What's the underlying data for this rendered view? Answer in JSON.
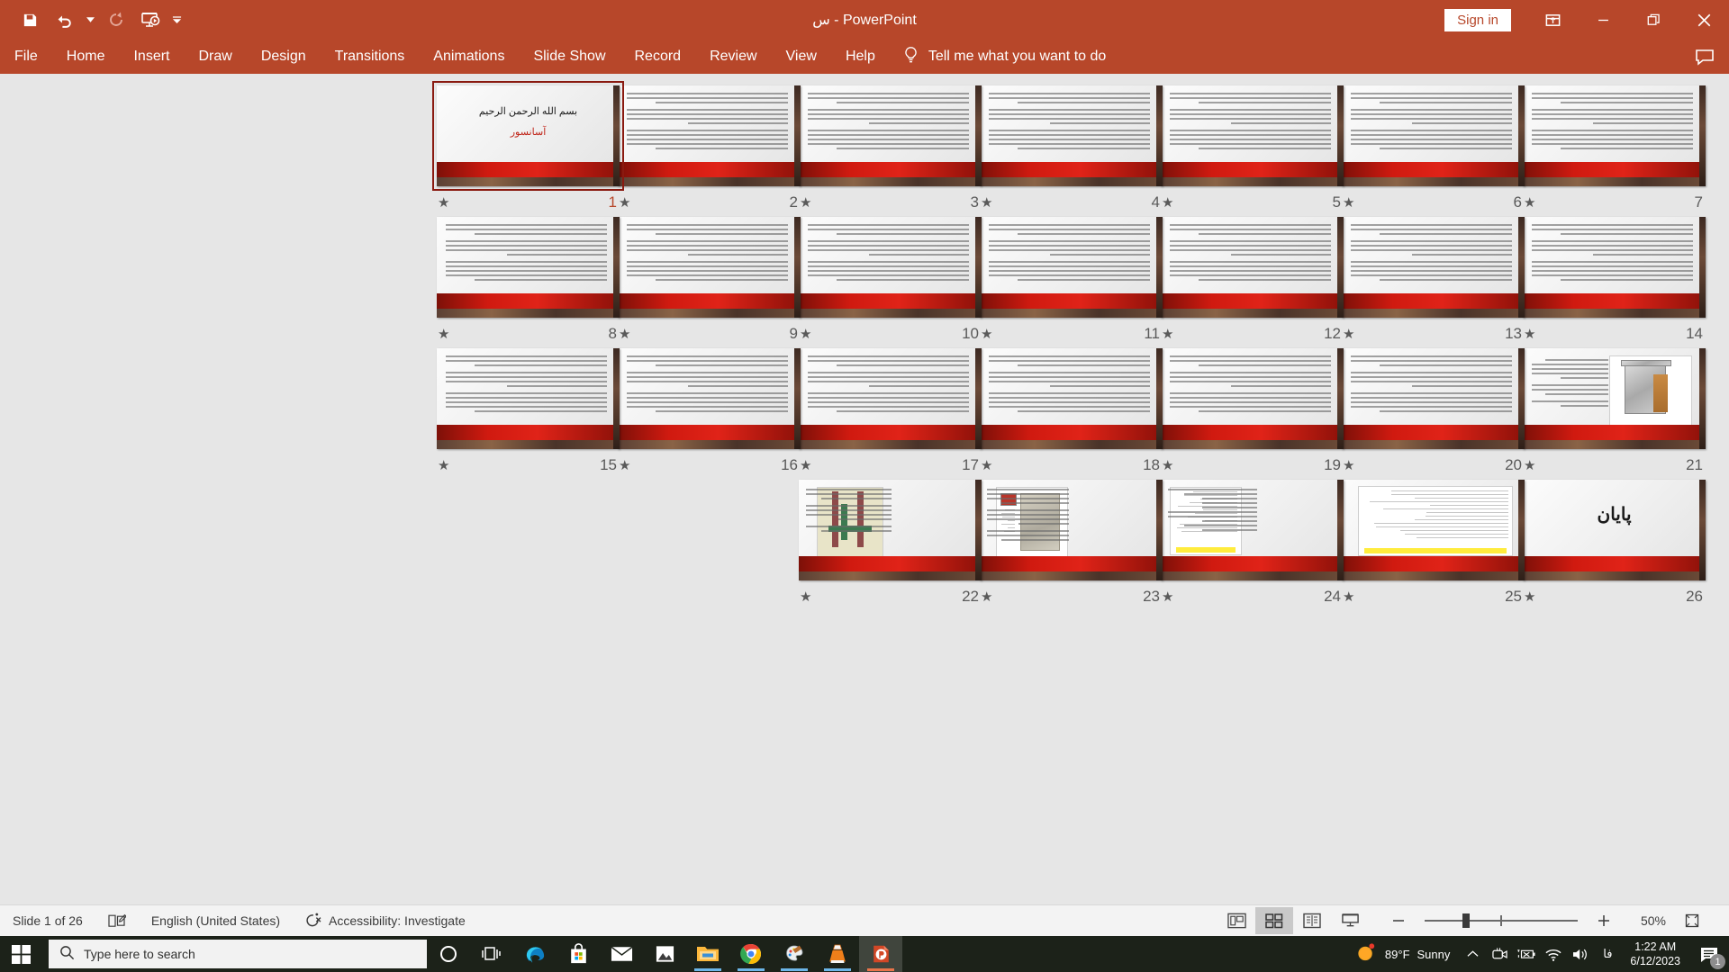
{
  "titlebar": {
    "document_title": "س  -  PowerPoint",
    "quick_access": [
      {
        "name": "save",
        "label": "Save",
        "icon": "save-icon"
      },
      {
        "name": "undo",
        "label": "Undo",
        "icon": "undo-icon"
      },
      {
        "name": "undo-dropdown",
        "label": "Undo options",
        "icon": "chevron-down-icon"
      },
      {
        "name": "redo",
        "label": "Redo",
        "icon": "redo-icon"
      },
      {
        "name": "start-slideshow",
        "label": "Start From Beginning",
        "icon": "slideshow-icon"
      },
      {
        "name": "customize-qat",
        "label": "Customize Quick Access Toolbar",
        "icon": "chevron-down-small-icon"
      }
    ],
    "signin_label": "Sign in",
    "ribbon_display_label": "Ribbon Display Options",
    "minimize_label": "Minimize",
    "restore_label": "Restore Down",
    "close_label": "Close"
  },
  "ribbon": {
    "tabs": [
      {
        "label": "File"
      },
      {
        "label": "Home"
      },
      {
        "label": "Insert"
      },
      {
        "label": "Draw"
      },
      {
        "label": "Design"
      },
      {
        "label": "Transitions"
      },
      {
        "label": "Animations"
      },
      {
        "label": "Slide Show"
      },
      {
        "label": "Record"
      },
      {
        "label": "Review"
      },
      {
        "label": "View"
      },
      {
        "label": "Help"
      }
    ],
    "tellme_placeholder": "Tell me what you want to do",
    "comments_label": "Comments"
  },
  "sorter": {
    "slides": [
      {
        "number": "7",
        "type": "text",
        "star": "★"
      },
      {
        "number": "6",
        "type": "text",
        "star": "★"
      },
      {
        "number": "5",
        "type": "text",
        "star": "★"
      },
      {
        "number": "4",
        "type": "text",
        "star": "★"
      },
      {
        "number": "3",
        "type": "text",
        "star": "★"
      },
      {
        "number": "2",
        "type": "text",
        "star": "★"
      },
      {
        "number": "1",
        "type": "title",
        "star": "★",
        "selected": true,
        "line1": "بسم الله الرحمن الرحيم",
        "line2": "آسانسور"
      },
      {
        "number": "14",
        "type": "text",
        "star": "★"
      },
      {
        "number": "13",
        "type": "text",
        "star": "★"
      },
      {
        "number": "12",
        "type": "text",
        "star": "★"
      },
      {
        "number": "11",
        "type": "text",
        "star": "★"
      },
      {
        "number": "10",
        "type": "text",
        "star": "★"
      },
      {
        "number": "9",
        "type": "text",
        "star": "★"
      },
      {
        "number": "8",
        "type": "text",
        "star": "★"
      },
      {
        "number": "21",
        "type": "diagram",
        "star": "★"
      },
      {
        "number": "20",
        "type": "text",
        "star": "★"
      },
      {
        "number": "19",
        "type": "text",
        "star": "★"
      },
      {
        "number": "18",
        "type": "text",
        "star": "★"
      },
      {
        "number": "17",
        "type": "text",
        "star": "★"
      },
      {
        "number": "16",
        "type": "text",
        "star": "★"
      },
      {
        "number": "15",
        "type": "text",
        "star": "★"
      },
      {
        "number": "26",
        "type": "end",
        "star": "★",
        "line1": "پایان"
      },
      {
        "number": "25",
        "type": "plan",
        "star": "★"
      },
      {
        "number": "24",
        "type": "plan2",
        "star": "★"
      },
      {
        "number": "23",
        "type": "cabin",
        "star": "★"
      },
      {
        "number": "22",
        "type": "rails",
        "star": "★"
      }
    ]
  },
  "statusbar": {
    "slide_counter": "Slide 1 of 26",
    "notes_icon_label": "Notes",
    "language": "English (United States)",
    "accessibility": "Accessibility: Investigate",
    "views": [
      {
        "name": "normal-view",
        "label": "Normal",
        "active": false
      },
      {
        "name": "slide-sorter-view",
        "label": "Slide Sorter",
        "active": true
      },
      {
        "name": "reading-view",
        "label": "Reading View",
        "active": false
      },
      {
        "name": "slideshow-view",
        "label": "Slide Show",
        "active": false
      }
    ],
    "zoom_out_label": "Zoom Out",
    "zoom_in_label": "Zoom In",
    "zoom_level": "50%",
    "fit_label": "Fit slide to current window"
  },
  "taskbar": {
    "start_label": "Start",
    "search_placeholder": "Type here to search",
    "items": [
      {
        "name": "cortana",
        "label": "Cortana"
      },
      {
        "name": "task-view",
        "label": "Task View"
      },
      {
        "name": "microsoft-edge",
        "label": "Microsoft Edge"
      },
      {
        "name": "microsoft-store",
        "label": "Microsoft Store"
      },
      {
        "name": "mail",
        "label": "Mail"
      },
      {
        "name": "photos",
        "label": "Photos"
      },
      {
        "name": "file-explorer",
        "label": "File Explorer",
        "running": true
      },
      {
        "name": "google-chrome",
        "label": "Google Chrome",
        "running": true
      },
      {
        "name": "paint",
        "label": "Paint",
        "running": true
      },
      {
        "name": "vlc",
        "label": "VLC media player",
        "running": true
      },
      {
        "name": "powerpoint",
        "label": "PowerPoint",
        "running": true,
        "active": true
      }
    ],
    "tray": {
      "weather_temp": "89°F",
      "weather_cond": "Sunny",
      "show_hidden_label": "Show hidden icons",
      "language": "فا",
      "time": "1:22 AM",
      "date": "6/12/2023",
      "notification_count": "1"
    }
  },
  "colors": {
    "office_accent": "#b7472a",
    "selection_border": "#8a1a10",
    "slide_band_red": "#d01a10",
    "taskbar": "#1c2219"
  }
}
